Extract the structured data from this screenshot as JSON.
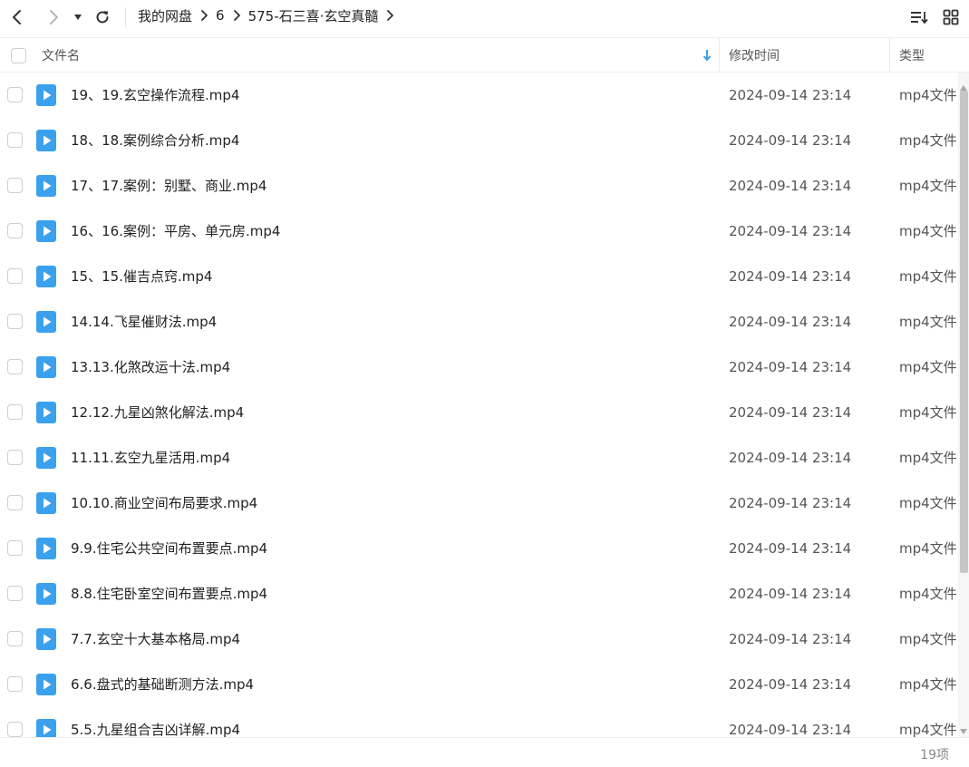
{
  "toolbar": {
    "icons": [
      "back-arrow-icon",
      "forward-arrow-icon",
      "history-dropdown-icon",
      "refresh-icon",
      "sort-order-icon",
      "grid-view-icon"
    ]
  },
  "breadcrumb": [
    "我的网盘",
    "6",
    "575-石三喜·玄空真髓"
  ],
  "columns": {
    "name": "文件名",
    "modified": "修改时间",
    "type": "类型"
  },
  "accent_color": "#3ba0ee",
  "files": [
    {
      "name": "19、19.玄空操作流程.mp4",
      "modified": "2024-09-14 23:14",
      "type": "mp4文件"
    },
    {
      "name": "18、18.案例综合分析.mp4",
      "modified": "2024-09-14 23:14",
      "type": "mp4文件"
    },
    {
      "name": "17、17.案例：别墅、商业.mp4",
      "modified": "2024-09-14 23:14",
      "type": "mp4文件"
    },
    {
      "name": "16、16.案例：平房、单元房.mp4",
      "modified": "2024-09-14 23:14",
      "type": "mp4文件"
    },
    {
      "name": "15、15.催吉点窍.mp4",
      "modified": "2024-09-14 23:14",
      "type": "mp4文件"
    },
    {
      "name": "14.14.飞星催财法.mp4",
      "modified": "2024-09-14 23:14",
      "type": "mp4文件"
    },
    {
      "name": "13.13.化煞改运十法.mp4",
      "modified": "2024-09-14 23:14",
      "type": "mp4文件"
    },
    {
      "name": "12.12.九星凶煞化解法.mp4",
      "modified": "2024-09-14 23:14",
      "type": "mp4文件"
    },
    {
      "name": "11.11.玄空九星活用.mp4",
      "modified": "2024-09-14 23:14",
      "type": "mp4文件"
    },
    {
      "name": "10.10.商业空间布局要求.mp4",
      "modified": "2024-09-14 23:14",
      "type": "mp4文件"
    },
    {
      "name": "9.9.住宅公共空间布置要点.mp4",
      "modified": "2024-09-14 23:14",
      "type": "mp4文件"
    },
    {
      "name": "8.8.住宅卧室空间布置要点.mp4",
      "modified": "2024-09-14 23:14",
      "type": "mp4文件"
    },
    {
      "name": "7.7.玄空十大基本格局.mp4",
      "modified": "2024-09-14 23:14",
      "type": "mp4文件"
    },
    {
      "name": "6.6.盘式的基础断测方法.mp4",
      "modified": "2024-09-14 23:14",
      "type": "mp4文件"
    },
    {
      "name": "5.5.九星组合吉凶详解.mp4",
      "modified": "2024-09-14 23:14",
      "type": "mp4文件"
    }
  ],
  "footer": {
    "item_count": "19项"
  }
}
